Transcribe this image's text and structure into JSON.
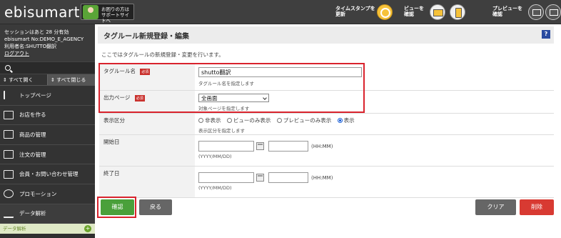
{
  "topbar": {
    "logo_main": "ebisumart",
    "support_text": "お困りの方は\nサポートサイトへ",
    "timestamp_label": "タイムスタンプを\n更新",
    "view_label": "ビューを\n確認",
    "preview_label": "プレビューを\n確認"
  },
  "sidebar": {
    "session_time": "セッションはあと 28 分有効",
    "store_no": "ebisumart No:DEMO_E_AGENCY",
    "user_name": "利用者名:SHUTTO翻訳",
    "logout": "ログアウト",
    "expand_all": "すべて開く",
    "collapse_all": "すべて閉じる",
    "items": [
      {
        "label": "トップページ"
      },
      {
        "label": "お店を作る"
      },
      {
        "label": "商品の管理"
      },
      {
        "label": "注文の管理"
      },
      {
        "label": "会員・お問い合わせ管理"
      },
      {
        "label": "プロモーション"
      },
      {
        "label": "データ解析"
      }
    ],
    "sub_item": "データ解析"
  },
  "main": {
    "title": "タグルール新規登録・編集",
    "help": "?",
    "intro": "ここではタグルールの新規登録・変更を行います。",
    "required_badge": "必須",
    "fields": {
      "tag_rule_name": {
        "label": "タグルール名",
        "value": "shutto翻訳",
        "hint": "タグルール名を指定します"
      },
      "output_page": {
        "label": "出力ページ",
        "value": "全画面",
        "hint": "対象ページを指定します"
      },
      "display_type": {
        "label": "表示区分",
        "options": [
          "非表示",
          "ビューのみ表示",
          "プレビューのみ表示",
          "表示"
        ],
        "selected": "表示",
        "hint": "表示区分を指定します"
      },
      "start_date": {
        "label": "開始日",
        "date_format": "(YYYY/MM/DD)",
        "time_format": "(HH:MM)"
      },
      "end_date": {
        "label": "終了日",
        "date_format": "(YYYY/MM/DD)",
        "time_format": "(HH:MM)"
      }
    },
    "buttons": {
      "confirm": "確認",
      "back": "戻る",
      "clear": "クリア",
      "delete": "削除"
    }
  },
  "colors": {
    "accent_green": "#4aa03a",
    "danger_red": "#d83a32",
    "highlight": "#d9232d"
  }
}
